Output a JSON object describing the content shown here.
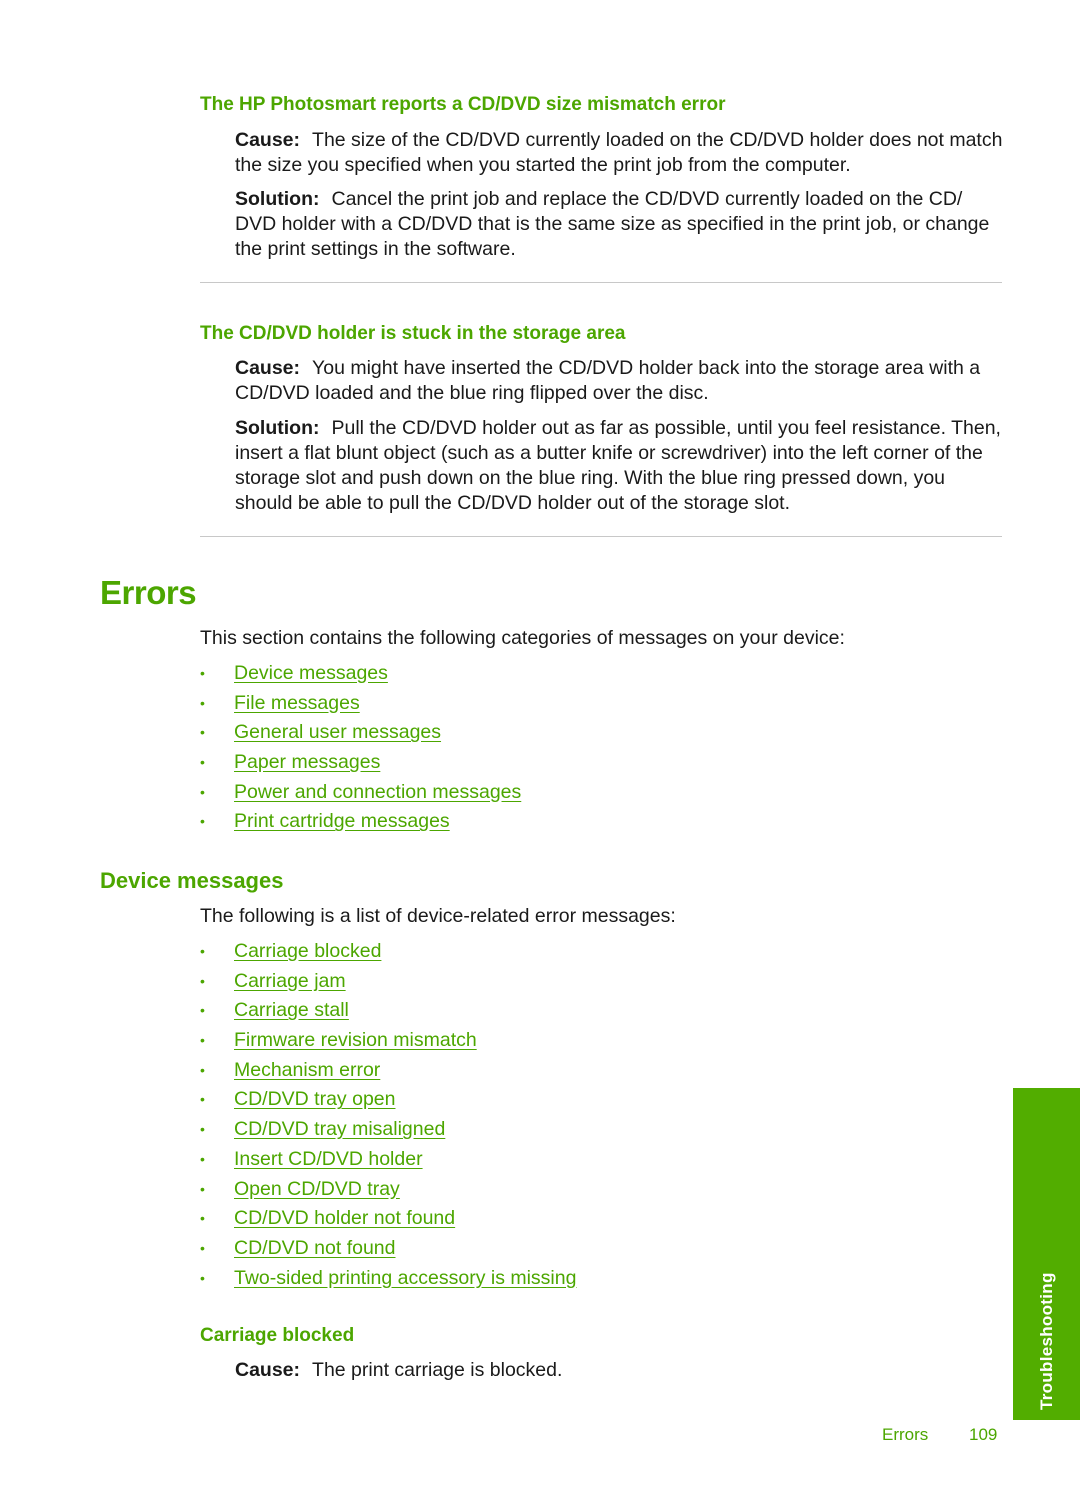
{
  "sections": {
    "size_mismatch": {
      "heading": "The HP Photosmart reports a CD/DVD size mismatch error",
      "cause_label": "Cause:",
      "cause_text": "The size of the CD/DVD currently loaded on the CD/DVD holder does not match the size you specified when you started the print job from the computer.",
      "solution_label": "Solution:",
      "solution_text": "Cancel the print job and replace the CD/DVD currently loaded on the CD/ DVD holder with a CD/DVD that is the same size as specified in the print job, or change the print settings in the software."
    },
    "holder_stuck": {
      "heading": "The CD/DVD holder is stuck in the storage area",
      "cause_label": "Cause:",
      "cause_text": "You might have inserted the CD/DVD holder back into the storage area with a CD/DVD loaded and the blue ring flipped over the disc.",
      "solution_label": "Solution:",
      "solution_text": "Pull the CD/DVD holder out as far as possible, until you feel resistance. Then, insert a flat blunt object (such as a butter knife or screwdriver) into the left corner of the storage slot and push down on the blue ring. With the blue ring pressed down, you should be able to pull the CD/DVD holder out of the storage slot."
    }
  },
  "errors": {
    "title": "Errors",
    "intro": "This section contains the following categories of messages on your device:",
    "links": [
      "Device messages",
      "File messages",
      "General user messages",
      "Paper messages",
      "Power and connection messages",
      "Print cartridge messages"
    ]
  },
  "device_messages": {
    "title": "Device messages",
    "intro": "The following is a list of device-related error messages:",
    "links": [
      "Carriage blocked",
      "Carriage jam",
      "Carriage stall",
      "Firmware revision mismatch",
      "Mechanism error",
      "CD/DVD tray open",
      "CD/DVD tray misaligned",
      "Insert CD/DVD holder",
      "Open CD/DVD tray",
      "CD/DVD holder not found",
      "CD/DVD not found",
      "Two-sided printing accessory is missing"
    ]
  },
  "carriage_blocked": {
    "heading": "Carriage blocked",
    "cause_label": "Cause:",
    "cause_text": "The print carriage is blocked."
  },
  "side_tab": {
    "label": "Troubleshooting"
  },
  "footer": {
    "section": "Errors",
    "page_number": "109"
  },
  "colors": {
    "accent_green": "#4ca600",
    "tab_green": "#52ad00",
    "body_text": "#1a1a1a",
    "divider": "#c8c8c8"
  }
}
